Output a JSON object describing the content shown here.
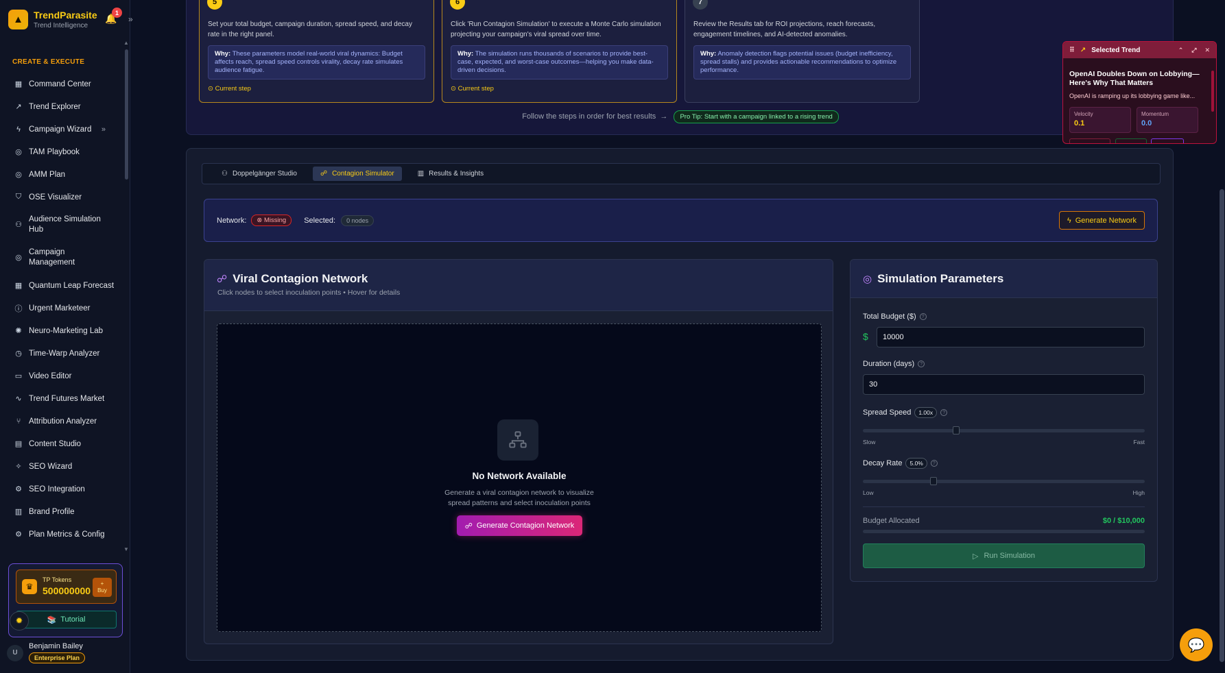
{
  "brand": {
    "name": "TrendParasite",
    "subtitle": "Trend Intelligence"
  },
  "notifications": {
    "count": "1"
  },
  "sidebar": {
    "section_title": "CREATE & EXECUTE",
    "items": [
      {
        "label": "Command Center",
        "icon": "grid-icon"
      },
      {
        "label": "Trend Explorer",
        "icon": "trend-icon"
      },
      {
        "label": "Campaign Wizard",
        "icon": "bolt-icon"
      },
      {
        "label": "TAM Playbook",
        "icon": "target-icon"
      },
      {
        "label": "AMM Plan",
        "icon": "target-icon"
      },
      {
        "label": "OSE Visualizer",
        "icon": "shield-icon"
      },
      {
        "label": "Audience Simulation Hub",
        "icon": "users-icon"
      },
      {
        "label": "Campaign Management",
        "icon": "target-icon"
      },
      {
        "label": "Quantum Leap Forecast",
        "icon": "grid-icon"
      },
      {
        "label": "Urgent Marketeer",
        "icon": "alert-icon"
      },
      {
        "label": "Neuro-Marketing Lab",
        "icon": "brain-icon"
      },
      {
        "label": "Time-Warp Analyzer",
        "icon": "clock-icon"
      },
      {
        "label": "Video Editor",
        "icon": "video-icon"
      },
      {
        "label": "Trend Futures Market",
        "icon": "wave-icon"
      },
      {
        "label": "Attribution Analyzer",
        "icon": "branch-icon"
      },
      {
        "label": "Content Studio",
        "icon": "doc-icon"
      },
      {
        "label": "SEO Wizard",
        "icon": "sparkle-icon"
      },
      {
        "label": "SEO Integration",
        "icon": "gear-icon"
      },
      {
        "label": "Brand Profile",
        "icon": "building-icon"
      },
      {
        "label": "Plan Metrics & Config",
        "icon": "gear-icon"
      }
    ]
  },
  "tokens": {
    "label": "TP Tokens",
    "value": "500000000",
    "buy_plus": "+",
    "buy_label": "Buy",
    "tutorial_label": "Tutorial"
  },
  "user": {
    "initial": "U",
    "name": "Benjamin Bailey",
    "plan": "Enterprise Plan"
  },
  "steps": [
    {
      "num": "5",
      "desc": "Set your total budget, campaign duration, spread speed, and decay rate in the right panel.",
      "why_label": "Why:",
      "why": "These parameters model real-world viral dynamics: Budget affects reach, spread speed controls virality, decay rate simulates audience fatigue.",
      "status": "Current step"
    },
    {
      "num": "6",
      "desc": "Click 'Run Contagion Simulation' to execute a Monte Carlo simulation projecting your campaign's viral spread over time.",
      "why_label": "Why:",
      "why": "The simulation runs thousands of scenarios to provide best-case, expected, and worst-case outcomes—helping you make data-driven decisions.",
      "status": "Current step"
    },
    {
      "num": "7",
      "desc": "Review the Results tab for ROI projections, reach forecasts, engagement timelines, and AI-detected anomalies.",
      "why_label": "Why:",
      "why": "Anomaly detection flags potential issues (budget inefficiency, spread stalls) and provides actionable recommendations to optimize performance."
    }
  ],
  "steps_footer": {
    "text": "Follow the steps in order for best results",
    "pro_tip": "Pro Tip: Start with a campaign linked to a rising trend"
  },
  "tabs": [
    {
      "label": "Doppelgänger Studio"
    },
    {
      "label": "Contagion Simulator"
    },
    {
      "label": "Results & Insights"
    }
  ],
  "network_bar": {
    "network_label": "Network:",
    "network_status": "Missing",
    "selected_label": "Selected:",
    "selected_value": "0 nodes",
    "generate_label": "Generate Network"
  },
  "network_card": {
    "title": "Viral Contagion Network",
    "subtitle": "Click nodes to select inoculation points • Hover for details",
    "empty_title": "No Network Available",
    "empty_line1": "Generate a viral contagion network to visualize",
    "empty_line2": "spread patterns and select inoculation points",
    "generate_label": "Generate Contagion Network"
  },
  "params": {
    "title": "Simulation Parameters",
    "budget_label": "Total Budget ($)",
    "budget_currency": "$",
    "budget_value": "10000",
    "duration_label": "Duration (days)",
    "duration_value": "30",
    "spread_label": "Spread Speed",
    "spread_value": "1.00x",
    "spread_min_label": "Slow",
    "spread_max_label": "Fast",
    "spread_position": 0.33,
    "decay_label": "Decay Rate",
    "decay_value": "5.0%",
    "decay_min_label": "Low",
    "decay_max_label": "High",
    "decay_position": 0.25,
    "allocated_label": "Budget Allocated",
    "allocated_value": "$0 / $10,000",
    "run_label": "Run Simulation"
  },
  "trend_widget": {
    "header": "Selected Trend",
    "title": "OpenAI Doubles Down on Lobbying—Here's Why That Matters",
    "desc": "OpenAI is ramping up its lobbying game like...",
    "velocity_label": "Velocity",
    "velocity_value": "0.1",
    "momentum_label": "Momentum",
    "momentum_value": "0.0"
  }
}
